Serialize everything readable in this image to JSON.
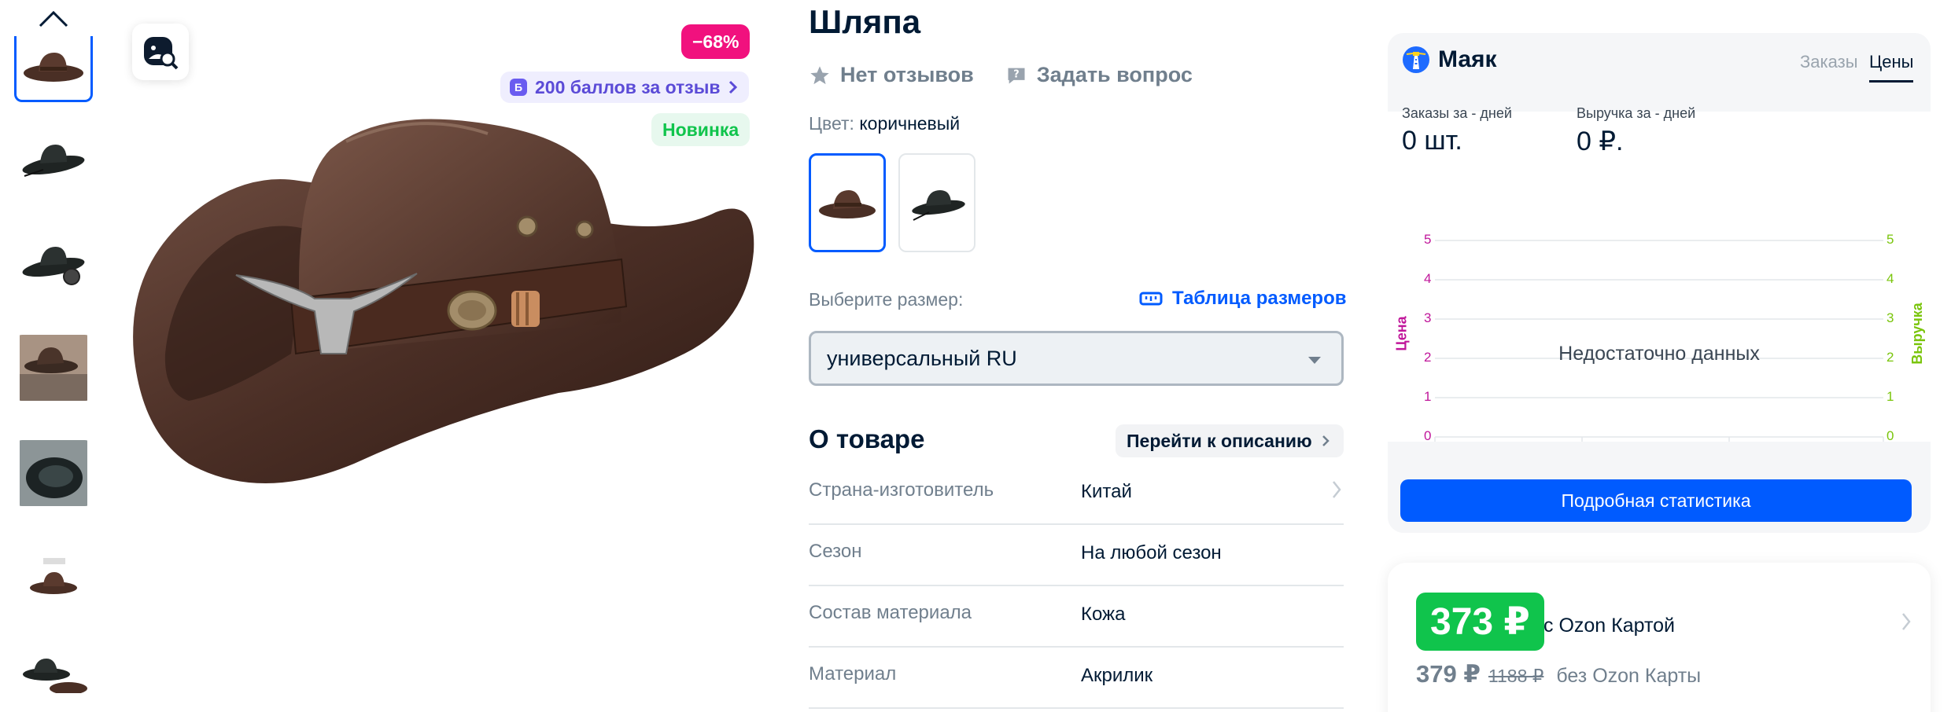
{
  "gallery": {
    "discount": "−68%",
    "points": "200 баллов за отзыв",
    "points_icon_letter": "Б",
    "new_badge": "Новинка"
  },
  "product": {
    "title": "Шляпа",
    "reviews": "Нет отзывов",
    "ask": "Задать вопрос",
    "color_label": "Цвет:",
    "color_value": "коричневый",
    "size_label": "Выберите размер:",
    "size_table": "Таблица размеров",
    "size_selected": "универсальный RU",
    "about_title": "О товаре",
    "goto_desc": "Перейти к описанию",
    "specs": [
      {
        "key": "Страна-изготовитель",
        "value": "Китай"
      },
      {
        "key": "Сезон",
        "value": "На любой сезон"
      },
      {
        "key": "Состав материала",
        "value": "Кожа"
      },
      {
        "key": "Материал",
        "value": "Акрилик"
      }
    ]
  },
  "mayak": {
    "brand": "Маяк",
    "tabs": [
      "Заказы",
      "Цены"
    ],
    "active_tab": "Цены",
    "orders_label": "Заказы за - дней",
    "orders_value": "0 шт.",
    "revenue_label": "Выручка за - дней",
    "revenue_value": "0 ₽.",
    "left_axis_title": "Цена",
    "right_axis_title": "Выручка",
    "ticks": [
      "5",
      "4",
      "3",
      "2",
      "1",
      "0"
    ],
    "no_data": "Недостаточно данных",
    "detail_button": "Подробная статистика"
  },
  "price": {
    "card_price": "373 ₽",
    "card_label": "с Ozon Картой",
    "price": "379 ₽",
    "old_price": "1188 ₽",
    "without_card": "без Ozon Карты"
  },
  "colors": {
    "accent": "#005bff",
    "discount": "#f1117e",
    "green": "#10c44c",
    "left_axis": "#c0169a",
    "right_axis": "#7ac50c"
  }
}
